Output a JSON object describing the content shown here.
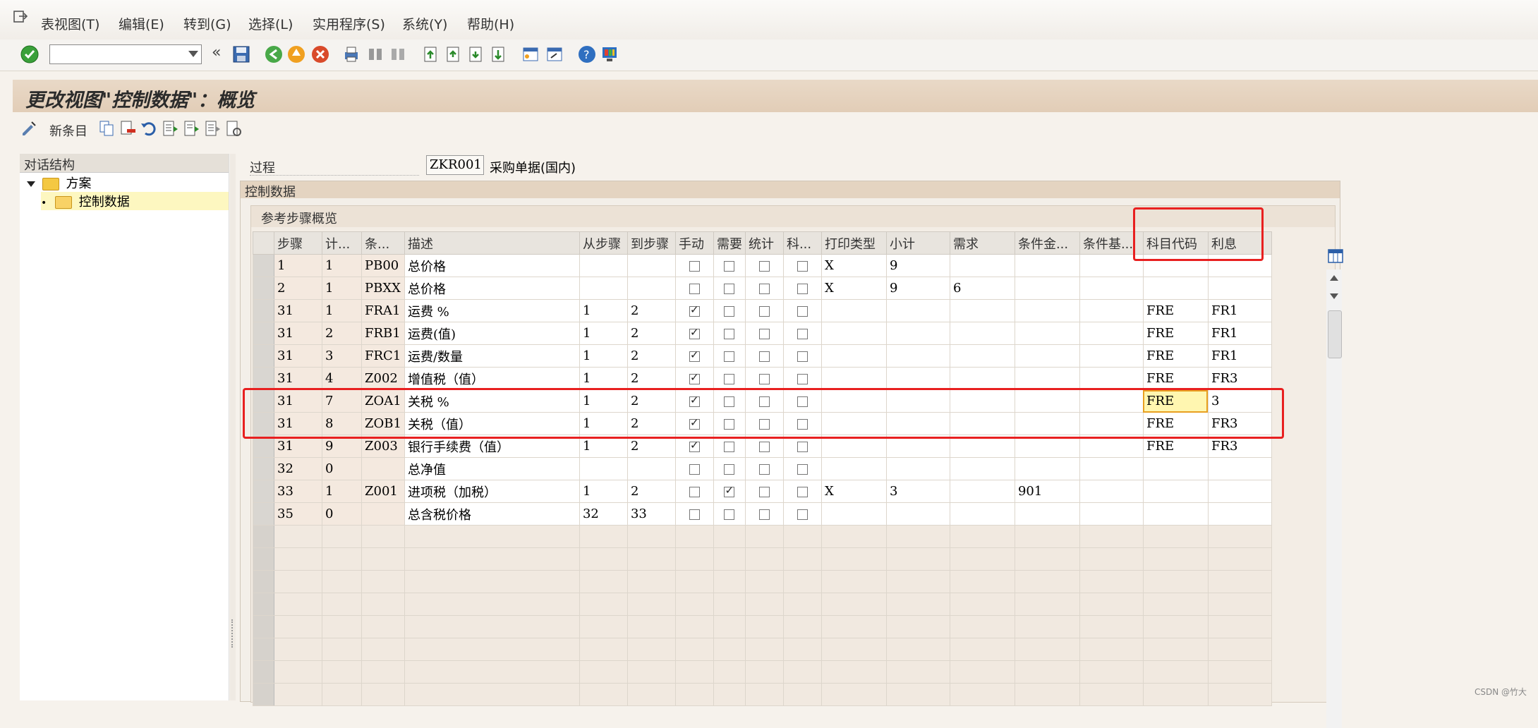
{
  "menubar": {
    "items": [
      "表视图(T)",
      "编辑(E)",
      "转到(G)",
      "选择(L)",
      "实用程序(S)",
      "系统(Y)",
      "帮助(H)"
    ]
  },
  "icons": {
    "enter": "check-icon",
    "back": "back-icon",
    "save": "save-icon",
    "exit": "exit-icon",
    "cancel": "cancel-icon",
    "print": "print-icon",
    "find": "find-icon",
    "help": "help-icon"
  },
  "toolbar": {
    "command_value": "",
    "expand_glyph": "«"
  },
  "title": "更改视图\"控制数据\"：概览",
  "app_toolbar": {
    "new_entries_label": "新条目"
  },
  "tree": {
    "header": "对话结构",
    "items": [
      {
        "label": "方案",
        "level": 0,
        "expanded": true
      },
      {
        "label": "控制数据",
        "level": 1,
        "selected": true
      }
    ]
  },
  "procedure": {
    "label": "过程",
    "value": "ZKR001",
    "description": "采购单据(国内)"
  },
  "control_frame_title": "控制数据",
  "table": {
    "title": "参考步骤概览",
    "columns": [
      "步骤",
      "计...",
      "条...",
      "描述",
      "从步骤",
      "到步骤",
      "手动",
      "需要",
      "统计",
      "科...",
      "打印类型",
      "小计",
      "需求",
      "条件金...",
      "条件基...",
      "科目代码",
      "利息"
    ],
    "rows": [
      {
        "step": "1",
        "counter": "1",
        "ctype": "PB00",
        "desc": "总价格",
        "from": "",
        "to": "",
        "manual": false,
        "required": false,
        "stat": false,
        "acct": false,
        "print": "X",
        "subtotal": "9",
        "req": "",
        "altamt": "",
        "altbase": "",
        "acctkey": "",
        "accrual": ""
      },
      {
        "step": "2",
        "counter": "1",
        "ctype": "PBXX",
        "desc": "总价格",
        "from": "",
        "to": "",
        "manual": false,
        "required": false,
        "stat": false,
        "acct": false,
        "print": "X",
        "subtotal": "9",
        "req": "6",
        "altamt": "",
        "altbase": "",
        "acctkey": "",
        "accrual": ""
      },
      {
        "step": "31",
        "counter": "1",
        "ctype": "FRA1",
        "desc": "运费 %",
        "from": "1",
        "to": "2",
        "manual": true,
        "required": false,
        "stat": false,
        "acct": false,
        "print": "",
        "subtotal": "",
        "req": "",
        "altamt": "",
        "altbase": "",
        "acctkey": "FRE",
        "accrual": "FR1"
      },
      {
        "step": "31",
        "counter": "2",
        "ctype": "FRB1",
        "desc": "运费(值)",
        "from": "1",
        "to": "2",
        "manual": true,
        "required": false,
        "stat": false,
        "acct": false,
        "print": "",
        "subtotal": "",
        "req": "",
        "altamt": "",
        "altbase": "",
        "acctkey": "FRE",
        "accrual": "FR1"
      },
      {
        "step": "31",
        "counter": "3",
        "ctype": "FRC1",
        "desc": "运费/数量",
        "from": "1",
        "to": "2",
        "manual": true,
        "required": false,
        "stat": false,
        "acct": false,
        "print": "",
        "subtotal": "",
        "req": "",
        "altamt": "",
        "altbase": "",
        "acctkey": "FRE",
        "accrual": "FR1"
      },
      {
        "step": "31",
        "counter": "4",
        "ctype": "Z002",
        "desc": "增值税（值）",
        "from": "1",
        "to": "2",
        "manual": true,
        "required": false,
        "stat": false,
        "acct": false,
        "print": "",
        "subtotal": "",
        "req": "",
        "altamt": "",
        "altbase": "",
        "acctkey": "FRE",
        "accrual": "FR3"
      },
      {
        "step": "31",
        "counter": "7",
        "ctype": "ZOA1",
        "desc": "关税 %",
        "from": "1",
        "to": "2",
        "manual": true,
        "required": false,
        "stat": false,
        "acct": false,
        "print": "",
        "subtotal": "",
        "req": "",
        "altamt": "",
        "altbase": "",
        "acctkey": "FRE",
        "accrual": "3"
      },
      {
        "step": "31",
        "counter": "8",
        "ctype": "ZOB1",
        "desc": "关税（值）",
        "from": "1",
        "to": "2",
        "manual": true,
        "required": false,
        "stat": false,
        "acct": false,
        "print": "",
        "subtotal": "",
        "req": "",
        "altamt": "",
        "altbase": "",
        "acctkey": "FRE",
        "accrual": "FR3"
      },
      {
        "step": "31",
        "counter": "9",
        "ctype": "Z003",
        "desc": "银行手续费（值）",
        "from": "1",
        "to": "2",
        "manual": true,
        "required": false,
        "stat": false,
        "acct": false,
        "print": "",
        "subtotal": "",
        "req": "",
        "altamt": "",
        "altbase": "",
        "acctkey": "FRE",
        "accrual": "FR3"
      },
      {
        "step": "32",
        "counter": "0",
        "ctype": "",
        "desc": "总净值",
        "from": "",
        "to": "",
        "manual": false,
        "required": false,
        "stat": false,
        "acct": false,
        "print": "",
        "subtotal": "",
        "req": "",
        "altamt": "",
        "altbase": "",
        "acctkey": "",
        "accrual": ""
      },
      {
        "step": "33",
        "counter": "1",
        "ctype": "Z001",
        "desc": "进项税（加税）",
        "from": "1",
        "to": "2",
        "manual": false,
        "required": true,
        "stat": false,
        "acct": false,
        "print": "X",
        "subtotal": "3",
        "req": "",
        "altamt": "901",
        "altbase": "",
        "acctkey": "",
        "accrual": ""
      },
      {
        "step": "35",
        "counter": "0",
        "ctype": "",
        "desc": "总含税价格",
        "from": "32",
        "to": "33",
        "manual": false,
        "required": false,
        "stat": false,
        "acct": false,
        "print": "",
        "subtotal": "",
        "req": "",
        "altamt": "",
        "altbase": "",
        "acctkey": "",
        "accrual": ""
      }
    ],
    "empty_rows": 8
  },
  "watermark": "CSDN @竹大"
}
